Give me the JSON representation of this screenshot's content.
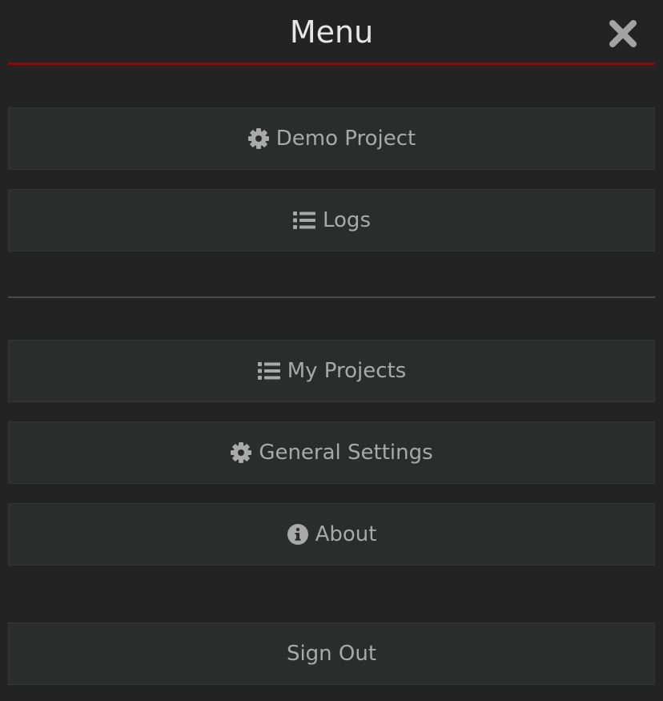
{
  "header": {
    "title": "Menu",
    "close_icon": "close-icon",
    "accent_color": "#7e1010"
  },
  "menu": {
    "project_items": [
      {
        "label": "Demo Project",
        "icon": "gear-icon"
      },
      {
        "label": "Logs",
        "icon": "list-icon"
      }
    ],
    "app_items": [
      {
        "label": "My Projects",
        "icon": "list-icon"
      },
      {
        "label": "General Settings",
        "icon": "gear-icon"
      },
      {
        "label": "About",
        "icon": "info-icon"
      }
    ],
    "sign_out": {
      "label": "Sign Out"
    }
  },
  "colors": {
    "background": "#232323",
    "item_background": "#2b2c2c",
    "item_text": "#a9a9a9",
    "title_text": "#e6e6e6"
  }
}
